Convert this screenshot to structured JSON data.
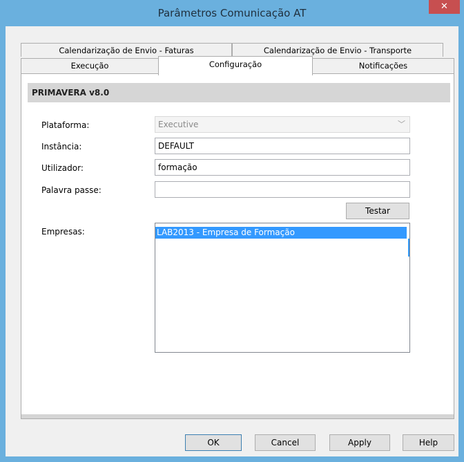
{
  "window": {
    "title": "Parâmetros Comunicação AT",
    "close_glyph": "✕"
  },
  "tabs": {
    "row1": [
      {
        "label": "Calendarização de Envio - Faturas"
      },
      {
        "label": "Calendarização de Envio - Transporte"
      }
    ],
    "row2": [
      {
        "label": "Execução"
      },
      {
        "label": "Configuração",
        "active": true
      },
      {
        "label": "Notificações"
      }
    ]
  },
  "section": {
    "title": "PRIMAVERA v8.0"
  },
  "form": {
    "plataforma": {
      "label": "Plataforma:",
      "value": "Executive",
      "disabled": true
    },
    "instancia": {
      "label": "Instância:",
      "value": "DEFAULT"
    },
    "utilizador": {
      "label": "Utilizador:",
      "value": "formação"
    },
    "palavra_passe": {
      "label": "Palavra passe:",
      "value": ""
    },
    "testar_label": "Testar",
    "empresas": {
      "label": "Empresas:",
      "items": [
        {
          "label": "LAB2013 - Empresa de Formação",
          "selected": true
        }
      ]
    }
  },
  "footer": {
    "ok": "OK",
    "cancel": "Cancel",
    "apply": "Apply",
    "help": "Help"
  },
  "icons": {
    "dropdown": "chevron-down-icon",
    "close": "close-icon"
  },
  "colors": {
    "titlebar": "#6ab0de",
    "close": "#c74f50",
    "selection": "#3399ff"
  }
}
